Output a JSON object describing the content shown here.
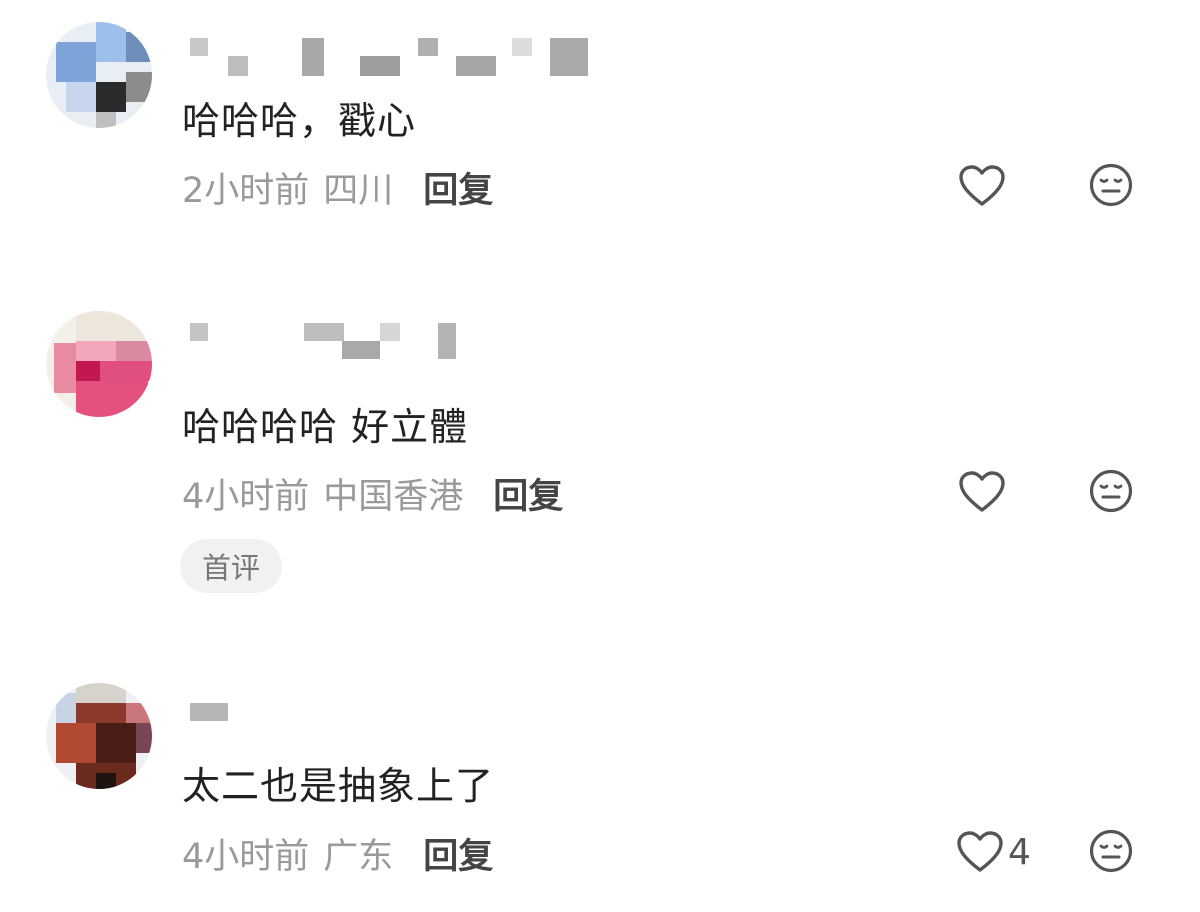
{
  "comments": [
    {
      "text": "哈哈哈，戳心",
      "time": "2小时前",
      "location": "四川",
      "reply_label": "回复",
      "likes": "",
      "badge": ""
    },
    {
      "text": "哈哈哈哈 好立體",
      "time": "4小时前",
      "location": "中国香港",
      "reply_label": "回复",
      "likes": "",
      "badge": "首评"
    },
    {
      "text": "太二也是抽象上了",
      "time": "4小时前",
      "location": "广东",
      "reply_label": "回复",
      "likes": "4",
      "badge": ""
    }
  ],
  "icons": {
    "like": "heart-icon",
    "dislike": "neutral-face-icon"
  },
  "colors": {
    "text": "#222222",
    "meta": "#9a9a9a",
    "reply": "#444444",
    "icon": "#555555",
    "badge_bg": "#f1f1f1"
  }
}
